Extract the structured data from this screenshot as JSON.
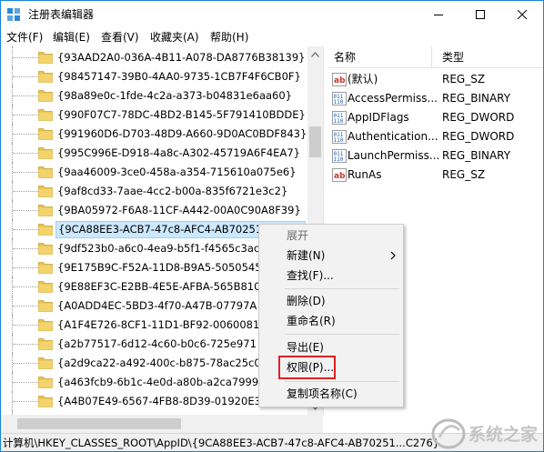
{
  "window": {
    "title": "注册表编辑器",
    "controls": {
      "minimize": "minimize",
      "maximize": "maximize",
      "close": "close"
    }
  },
  "menubar": {
    "items": [
      "文件(F)",
      "编辑(E)",
      "查看(V)",
      "收藏夹(A)",
      "帮助(H)"
    ]
  },
  "tree": {
    "items": [
      "{93AAD2A0-036A-4B11-A078-DA8776B38139}",
      "{98457147-39B0-4AA0-9735-1CB7F4F6CB0F}",
      "{98a89e0c-1fde-4c2a-a373-b04831e6aa60}",
      "{990F07C7-78DC-4BD2-B145-5F791410BDDE}",
      "{991960D6-D703-48D9-A660-9D0AC0BDF843}",
      "{995C996E-D918-4a8c-A302-45719A6F4EA7}",
      "{9aa46009-3ce0-458a-a354-715610a075e6}",
      "{9af8cd33-7aae-4cc2-b00a-835f6721e3c2}",
      "{9BA05972-F6A8-11CF-A442-00A0C90A8F39}",
      "{9CA88EE3-ACB7-47c8-AFC4-AB702511C276}",
      "{9df523b0-a6c0-4ea9-b5f1-f4565c3ac",
      "{9E175B9C-F52A-11D8-B9A5-5050545",
      "{9E88EF3C-E2BB-4E5E-AFBA-565B810",
      "{A0ADD4EC-5BD3-4f70-A47B-07797A",
      "{A1F4E726-8CF1-11D1-BF92-0060081",
      "{a2b77517-6d12-4c60-b0c6-725e971",
      "{a2d9ca22-a492-400c-b875-78ac25c0",
      "{a463fcb9-6b1c-4e0d-a80b-a2ca7999",
      "{A4B07E49-6567-4FB8-8D39-01920E3",
      "{a4c31131-ff70-4984-afd6-0609ced53"
    ],
    "selected_index": 9
  },
  "list": {
    "headers": {
      "name": "名称",
      "type": "类型"
    },
    "rows": [
      {
        "name": "(默认)",
        "type": "REG_SZ",
        "icon": "string-value-icon"
      },
      {
        "name": "AccessPermiss...",
        "type": "REG_BINARY",
        "icon": "binary-value-icon"
      },
      {
        "name": "AppIDFlags",
        "type": "REG_DWORD",
        "icon": "binary-value-icon"
      },
      {
        "name": "Authentication...",
        "type": "REG_DWORD",
        "icon": "binary-value-icon"
      },
      {
        "name": "LaunchPermiss...",
        "type": "REG_BINARY",
        "icon": "binary-value-icon"
      },
      {
        "name": "RunAs",
        "type": "REG_SZ",
        "icon": "string-value-icon"
      }
    ]
  },
  "context_menu": {
    "items": [
      {
        "label": "展开",
        "disabled": true
      },
      {
        "label": "新建(N)",
        "submenu": true
      },
      {
        "label": "查找(F)..."
      },
      {
        "separator": true
      },
      {
        "label": "删除(D)"
      },
      {
        "label": "重命名(R)"
      },
      {
        "separator": true
      },
      {
        "label": "导出(E)"
      },
      {
        "label": "权限(P)...",
        "highlighted": true
      },
      {
        "separator": true
      },
      {
        "label": "复制项名称(C)"
      }
    ]
  },
  "statusbar": {
    "path": "计算机\\HKEY_CLASSES_ROOT\\AppID\\{9CA88EE3-ACB7-47c8-AFC4-AB70251...C276}"
  },
  "watermark": {
    "text": "系统之家"
  },
  "colors": {
    "selection_bg": "#cce8ff",
    "selection_border": "#99d1ff",
    "folder": "#e8c14e",
    "highlight_box": "#e02020",
    "window_border": "#1883d7"
  }
}
